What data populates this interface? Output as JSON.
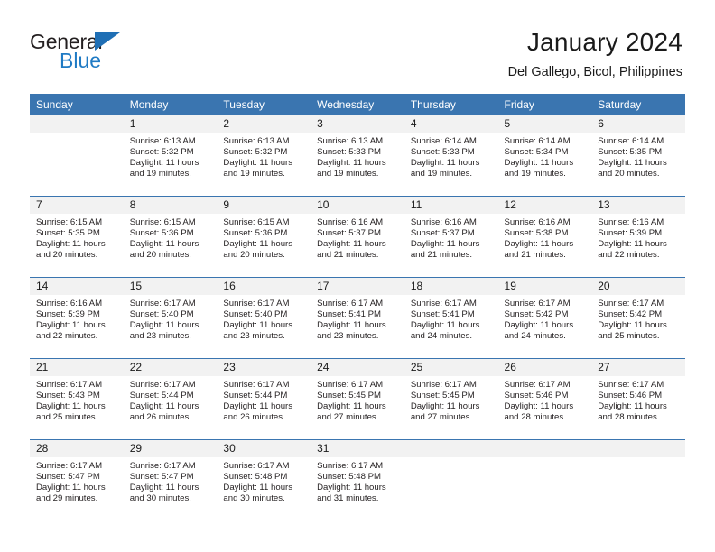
{
  "brand": {
    "name_top": "General",
    "name_bottom": "Blue",
    "triangle_color": "#1f6fb5",
    "blue_color": "#1f7ac4"
  },
  "header": {
    "title": "January 2024",
    "subtitle": "Del Gallego, Bicol, Philippines"
  },
  "theme": {
    "header_blue": "#3a75b0",
    "daynum_bg": "#f2f2f2",
    "text": "#231f20"
  },
  "calendar": {
    "weekdays": [
      "Sunday",
      "Monday",
      "Tuesday",
      "Wednesday",
      "Thursday",
      "Friday",
      "Saturday"
    ],
    "weeks": [
      [
        {
          "day": "",
          "sunrise": "",
          "sunset": "",
          "daylight": "",
          "empty": true
        },
        {
          "day": "1",
          "sunrise": "Sunrise: 6:13 AM",
          "sunset": "Sunset: 5:32 PM",
          "daylight": "Daylight: 11 hours and 19 minutes."
        },
        {
          "day": "2",
          "sunrise": "Sunrise: 6:13 AM",
          "sunset": "Sunset: 5:32 PM",
          "daylight": "Daylight: 11 hours and 19 minutes."
        },
        {
          "day": "3",
          "sunrise": "Sunrise: 6:13 AM",
          "sunset": "Sunset: 5:33 PM",
          "daylight": "Daylight: 11 hours and 19 minutes."
        },
        {
          "day": "4",
          "sunrise": "Sunrise: 6:14 AM",
          "sunset": "Sunset: 5:33 PM",
          "daylight": "Daylight: 11 hours and 19 minutes."
        },
        {
          "day": "5",
          "sunrise": "Sunrise: 6:14 AM",
          "sunset": "Sunset: 5:34 PM",
          "daylight": "Daylight: 11 hours and 19 minutes."
        },
        {
          "day": "6",
          "sunrise": "Sunrise: 6:14 AM",
          "sunset": "Sunset: 5:35 PM",
          "daylight": "Daylight: 11 hours and 20 minutes."
        }
      ],
      [
        {
          "day": "7",
          "sunrise": "Sunrise: 6:15 AM",
          "sunset": "Sunset: 5:35 PM",
          "daylight": "Daylight: 11 hours and 20 minutes."
        },
        {
          "day": "8",
          "sunrise": "Sunrise: 6:15 AM",
          "sunset": "Sunset: 5:36 PM",
          "daylight": "Daylight: 11 hours and 20 minutes."
        },
        {
          "day": "9",
          "sunrise": "Sunrise: 6:15 AM",
          "sunset": "Sunset: 5:36 PM",
          "daylight": "Daylight: 11 hours and 20 minutes."
        },
        {
          "day": "10",
          "sunrise": "Sunrise: 6:16 AM",
          "sunset": "Sunset: 5:37 PM",
          "daylight": "Daylight: 11 hours and 21 minutes."
        },
        {
          "day": "11",
          "sunrise": "Sunrise: 6:16 AM",
          "sunset": "Sunset: 5:37 PM",
          "daylight": "Daylight: 11 hours and 21 minutes."
        },
        {
          "day": "12",
          "sunrise": "Sunrise: 6:16 AM",
          "sunset": "Sunset: 5:38 PM",
          "daylight": "Daylight: 11 hours and 21 minutes."
        },
        {
          "day": "13",
          "sunrise": "Sunrise: 6:16 AM",
          "sunset": "Sunset: 5:39 PM",
          "daylight": "Daylight: 11 hours and 22 minutes."
        }
      ],
      [
        {
          "day": "14",
          "sunrise": "Sunrise: 6:16 AM",
          "sunset": "Sunset: 5:39 PM",
          "daylight": "Daylight: 11 hours and 22 minutes."
        },
        {
          "day": "15",
          "sunrise": "Sunrise: 6:17 AM",
          "sunset": "Sunset: 5:40 PM",
          "daylight": "Daylight: 11 hours and 23 minutes."
        },
        {
          "day": "16",
          "sunrise": "Sunrise: 6:17 AM",
          "sunset": "Sunset: 5:40 PM",
          "daylight": "Daylight: 11 hours and 23 minutes."
        },
        {
          "day": "17",
          "sunrise": "Sunrise: 6:17 AM",
          "sunset": "Sunset: 5:41 PM",
          "daylight": "Daylight: 11 hours and 23 minutes."
        },
        {
          "day": "18",
          "sunrise": "Sunrise: 6:17 AM",
          "sunset": "Sunset: 5:41 PM",
          "daylight": "Daylight: 11 hours and 24 minutes."
        },
        {
          "day": "19",
          "sunrise": "Sunrise: 6:17 AM",
          "sunset": "Sunset: 5:42 PM",
          "daylight": "Daylight: 11 hours and 24 minutes."
        },
        {
          "day": "20",
          "sunrise": "Sunrise: 6:17 AM",
          "sunset": "Sunset: 5:42 PM",
          "daylight": "Daylight: 11 hours and 25 minutes."
        }
      ],
      [
        {
          "day": "21",
          "sunrise": "Sunrise: 6:17 AM",
          "sunset": "Sunset: 5:43 PM",
          "daylight": "Daylight: 11 hours and 25 minutes."
        },
        {
          "day": "22",
          "sunrise": "Sunrise: 6:17 AM",
          "sunset": "Sunset: 5:44 PM",
          "daylight": "Daylight: 11 hours and 26 minutes."
        },
        {
          "day": "23",
          "sunrise": "Sunrise: 6:17 AM",
          "sunset": "Sunset: 5:44 PM",
          "daylight": "Daylight: 11 hours and 26 minutes."
        },
        {
          "day": "24",
          "sunrise": "Sunrise: 6:17 AM",
          "sunset": "Sunset: 5:45 PM",
          "daylight": "Daylight: 11 hours and 27 minutes."
        },
        {
          "day": "25",
          "sunrise": "Sunrise: 6:17 AM",
          "sunset": "Sunset: 5:45 PM",
          "daylight": "Daylight: 11 hours and 27 minutes."
        },
        {
          "day": "26",
          "sunrise": "Sunrise: 6:17 AM",
          "sunset": "Sunset: 5:46 PM",
          "daylight": "Daylight: 11 hours and 28 minutes."
        },
        {
          "day": "27",
          "sunrise": "Sunrise: 6:17 AM",
          "sunset": "Sunset: 5:46 PM",
          "daylight": "Daylight: 11 hours and 28 minutes."
        }
      ],
      [
        {
          "day": "28",
          "sunrise": "Sunrise: 6:17 AM",
          "sunset": "Sunset: 5:47 PM",
          "daylight": "Daylight: 11 hours and 29 minutes."
        },
        {
          "day": "29",
          "sunrise": "Sunrise: 6:17 AM",
          "sunset": "Sunset: 5:47 PM",
          "daylight": "Daylight: 11 hours and 30 minutes."
        },
        {
          "day": "30",
          "sunrise": "Sunrise: 6:17 AM",
          "sunset": "Sunset: 5:48 PM",
          "daylight": "Daylight: 11 hours and 30 minutes."
        },
        {
          "day": "31",
          "sunrise": "Sunrise: 6:17 AM",
          "sunset": "Sunset: 5:48 PM",
          "daylight": "Daylight: 11 hours and 31 minutes."
        },
        {
          "day": "",
          "sunrise": "",
          "sunset": "",
          "daylight": "",
          "empty": true
        },
        {
          "day": "",
          "sunrise": "",
          "sunset": "",
          "daylight": "",
          "empty": true
        },
        {
          "day": "",
          "sunrise": "",
          "sunset": "",
          "daylight": "",
          "empty": true
        }
      ]
    ]
  }
}
